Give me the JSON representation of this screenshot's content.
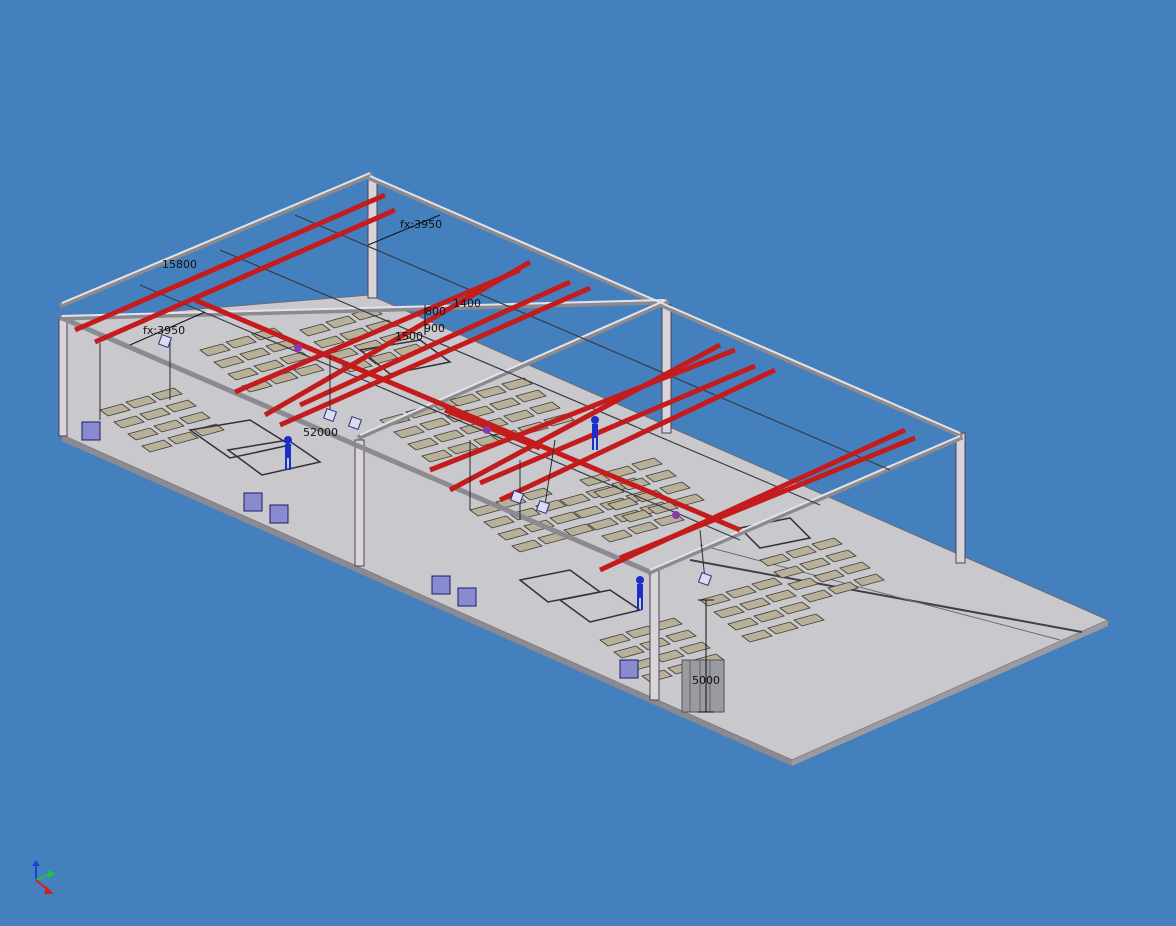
{
  "dimensions": {
    "length_top": "15800",
    "fx_right": "fx:3950",
    "fx_left": "fx:3950",
    "d_1400": "1400",
    "d_800": "800",
    "d_900": "900",
    "d_1500": "1500",
    "d_52000": "52000",
    "height": "5000"
  },
  "colors": {
    "background": "#4580be",
    "floor": "#c8c8cc",
    "beam_red": "#c81e1e",
    "frame": "#d0d0d4",
    "worker": "#1a2fc8"
  },
  "icons": {
    "axis_triad": "view-orientation-triad-icon"
  }
}
